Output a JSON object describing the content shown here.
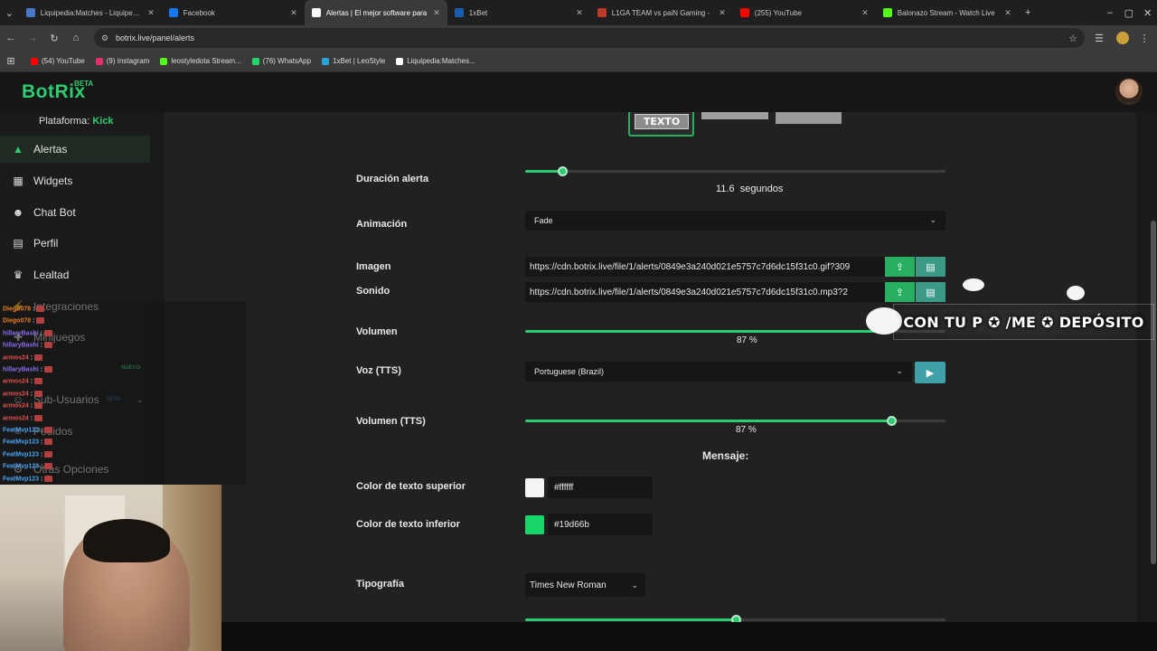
{
  "browser": {
    "tabs": [
      {
        "title": "Liquipedia:Matches - Liquipedia",
        "color": "#4a78c8"
      },
      {
        "title": "Facebook",
        "color": "#1877f2"
      },
      {
        "title": "Alertas | El mejor software para",
        "color": "#ffffff"
      },
      {
        "title": "1xBet",
        "color": "#1a5cb0"
      },
      {
        "title": "L1GA TEAM vs paiN Gaming -",
        "color": "#c0392b"
      },
      {
        "title": "(255) YouTube",
        "color": "#ff0000"
      },
      {
        "title": "Balonazo Stream - Watch Live",
        "color": "#53fc18"
      }
    ],
    "url": "botrix.live/panel/alerts",
    "bookmarks": [
      {
        "label": "(54) YouTube",
        "color": "#ff0000"
      },
      {
        "label": "(9) Instagram",
        "color": "#e1306c"
      },
      {
        "label": "leostyledota Stream...",
        "color": "#53fc18"
      },
      {
        "label": "(76) WhatsApp",
        "color": "#25d366"
      },
      {
        "label": "1xBet | LeoStyle",
        "color": "#2aa1da"
      },
      {
        "label": "Liquipedia:Matches...",
        "color": "#ffffff"
      }
    ]
  },
  "app": {
    "logo": "BotRix",
    "beta": "BETA",
    "platform_label": "Plataforma:",
    "platform_value": "Kick"
  },
  "sidebar": {
    "items": [
      {
        "label": "Alertas",
        "icon": "warning-icon"
      },
      {
        "label": "Widgets",
        "icon": "grid-icon"
      },
      {
        "label": "Chat Bot",
        "icon": "robot-icon"
      },
      {
        "label": "Perfil",
        "icon": "id-card-icon"
      },
      {
        "label": "Lealtad",
        "icon": "trophy-icon"
      },
      {
        "label": "Integraciones",
        "icon": "plug-icon"
      },
      {
        "label": "Minijuegos",
        "icon": "gamepad-icon"
      },
      {
        "label": "Sub-Usuarios",
        "icon": "users-icon"
      },
      {
        "label": "Pedidos",
        "icon": "list-icon"
      },
      {
        "label": "Otras Opciones",
        "icon": "gear-icon"
      }
    ],
    "nuevo": "NUEVO",
    "beta_badge": "BETA"
  },
  "chat": [
    {
      "user": "Diego078",
      "color": "#e67e22"
    },
    {
      "user": "Diego078",
      "color": "#e67e22"
    },
    {
      "user": "hillaryBashi",
      "color": "#8e6cf0"
    },
    {
      "user": "hillaryBashi",
      "color": "#8e6cf0"
    },
    {
      "user": "armos24",
      "color": "#e0504d"
    },
    {
      "user": "hillaryBashi",
      "color": "#8e6cf0"
    },
    {
      "user": "armos24",
      "color": "#e0504d"
    },
    {
      "user": "armos24",
      "color": "#e0504d"
    },
    {
      "user": "armos24",
      "color": "#e0504d"
    },
    {
      "user": "armos24",
      "color": "#e0504d"
    },
    {
      "user": "FeatMvp123",
      "color": "#4aa3f0"
    },
    {
      "user": "FeatMvp123",
      "color": "#4aa3f0"
    },
    {
      "user": "FeatMvp123",
      "color": "#4aa3f0"
    },
    {
      "user": "FeatMvp123",
      "color": "#4aa3f0"
    },
    {
      "user": "FeatMvp123",
      "color": "#4aa3f0"
    }
  ],
  "tabs_preview": {
    "texto": "TEXTO"
  },
  "form": {
    "duracion_label": "Duración alerta",
    "duracion_value": "11.6",
    "duracion_unit": "segundos",
    "duracion_fraction": 0.088,
    "animacion_label": "Animación",
    "animacion_value": "Fade",
    "imagen_label": "Imagen",
    "imagen_value": "https://cdn.botrix.live/file/1/alerts/0849e3a240d021e5757c7d6dc15f31c0.gif?309",
    "sonido_label": "Sonido",
    "sonido_value": "https://cdn.botrix.live/file/1/alerts/0849e3a240d021e5757c7d6dc15f31c0.mp3?2",
    "volumen_label": "Volumen",
    "volumen_value": "87 %",
    "volumen_fraction": 0.87,
    "voz_label": "Voz (TTS)",
    "voz_value": "Portuguese (Brazil)",
    "voltts_label": "Volumen (TTS)",
    "voltts_value": "87 %",
    "voltts_fraction": 0.87,
    "mensaje_label": "Mensaje:",
    "color_sup_label": "Color de texto superior",
    "color_sup_value": "#ffffff",
    "color_inf_label": "Color de texto inferior",
    "color_inf_value": "#19d66b",
    "tipografia_label": "Tipografía",
    "tipografia_value": "Times New Roman",
    "last_slider_fraction": 0.5
  },
  "overlay_banner": "CON TU P ✪ /ME ✪ DEPÓSITO"
}
